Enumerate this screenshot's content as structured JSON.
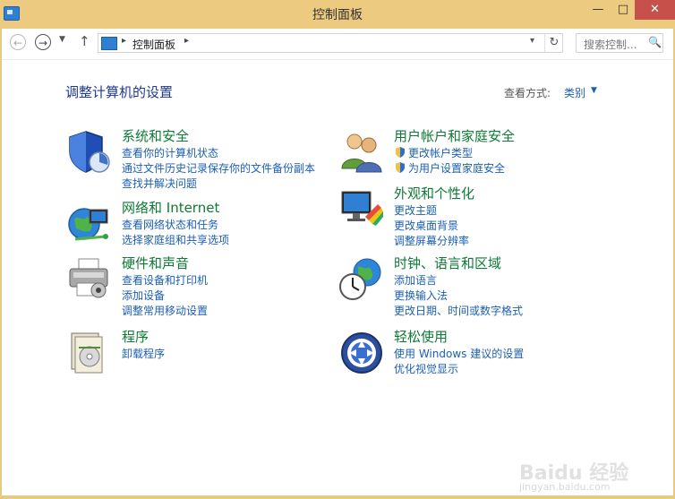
{
  "window": {
    "title": "控制面板",
    "minimize": "—",
    "maximize": "□",
    "close": "✕"
  },
  "nav": {
    "back": "←",
    "forward": "→",
    "recent": "▼",
    "up": "↑",
    "address_sep": "▸",
    "address_crumb": "控制面板",
    "address_sep2": "▸",
    "address_drop": "▾",
    "refresh": "↻",
    "search_placeholder": "搜索控制...",
    "search_icon": "🔍"
  },
  "page": {
    "title": "调整计算机的设置",
    "view_by_label": "查看方式:",
    "view_by_value": "类别",
    "view_by_arrow": "▼"
  },
  "categories": {
    "system": {
      "title": "系统和安全",
      "icon": "shield-icon",
      "links": [
        "查看你的计算机状态",
        "通过文件历史记录保存你的文件备份副本",
        "查找并解决问题"
      ]
    },
    "network": {
      "title": "网络和 Internet",
      "icon": "network-globe-icon",
      "links": [
        "查看网络状态和任务",
        "选择家庭组和共享选项"
      ]
    },
    "hardware": {
      "title": "硬件和声音",
      "icon": "printer-icon",
      "links": [
        "查看设备和打印机",
        "添加设备",
        "调整常用移动设置"
      ]
    },
    "programs": {
      "title": "程序",
      "icon": "programs-icon",
      "links": [
        "卸载程序"
      ]
    },
    "users": {
      "title": "用户帐户和家庭安全",
      "icon": "users-icon",
      "links": [
        "更改帐户类型",
        "为用户设置家庭安全"
      ]
    },
    "appearance": {
      "title": "外观和个性化",
      "icon": "monitor-paint-icon",
      "links": [
        "更改主题",
        "更改桌面背景",
        "调整屏幕分辨率"
      ]
    },
    "clock": {
      "title": "时钟、语言和区域",
      "icon": "clock-globe-icon",
      "links": [
        "添加语言",
        "更换输入法",
        "更改日期、时间或数字格式"
      ]
    },
    "ease": {
      "title": "轻松使用",
      "icon": "ease-of-access-icon",
      "links": [
        "使用 Windows 建议的设置",
        "优化视觉显示"
      ]
    }
  },
  "watermark": {
    "brand": "Baidu 经验",
    "url": "jingyan.baidu.com"
  },
  "colors": {
    "title_bar": "#ecca7f",
    "category_title": "#0d7a35",
    "link": "#1b5fb3",
    "heading": "#1e3a8a",
    "close_button": "#c7504b"
  }
}
